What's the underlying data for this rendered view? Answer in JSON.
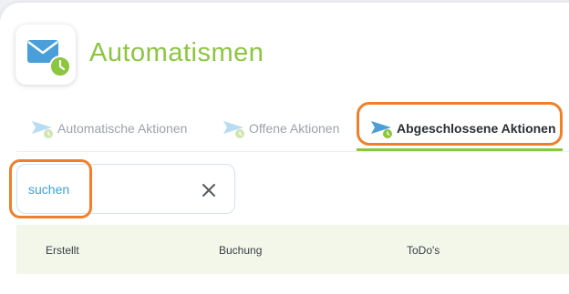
{
  "app": {
    "title": "Automatismen",
    "icon": "mail-clock-icon",
    "accent_color": "#8cc63f",
    "highlight_color": "#f07f2b"
  },
  "tabs": [
    {
      "label": "Automatische Aktionen",
      "icon": "paper-plane-clock-icon",
      "active": false
    },
    {
      "label": "Offene Aktionen",
      "icon": "paper-plane-clock-icon",
      "active": false
    },
    {
      "label": "Abgeschlossene Aktionen",
      "icon": "paper-plane-clock-icon",
      "active": true
    }
  ],
  "search": {
    "value": "suchen",
    "clear_icon": "close-icon"
  },
  "table": {
    "columns": [
      "Erstellt",
      "Buchung",
      "ToDo's"
    ]
  }
}
